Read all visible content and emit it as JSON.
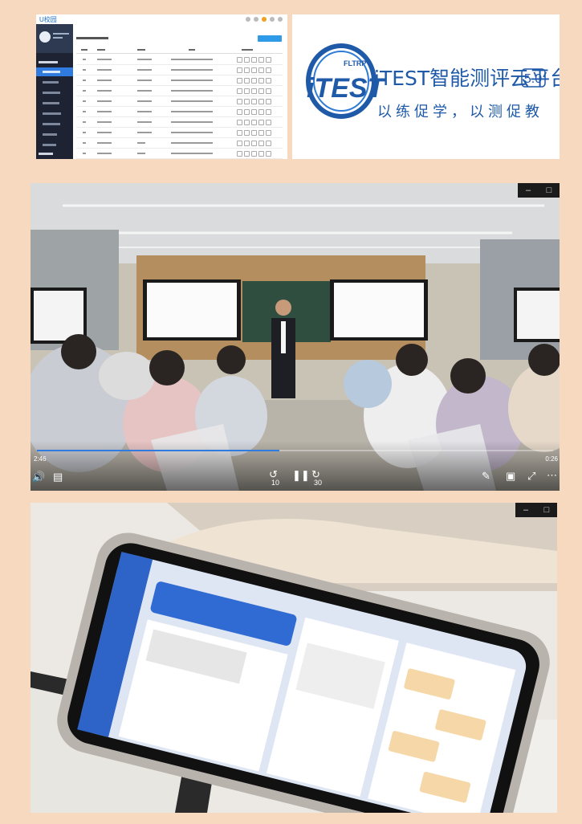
{
  "lms": {
    "logo": "U校园"
  },
  "itest": {
    "brand": "iTEST智能测评云平台",
    "version": "5.0",
    "slogan": "以练促学，以测促教",
    "badge_top": "FLTRP",
    "badge_main": "iTEST",
    "brand_blue": "#1f5aa8"
  },
  "video1": {
    "time_current": "2:46",
    "time_total": "0:26",
    "skip_back": "10",
    "skip_forward": "30",
    "progress": 0.47,
    "window_controls": [
      "–",
      "□"
    ]
  },
  "video2": {
    "window_controls": [
      "–",
      "□"
    ]
  },
  "icons": {
    "volume": "volume-icon",
    "captions": "captions-icon",
    "rewind": "rewind-icon",
    "pause": "pause-icon",
    "forward": "forward-icon",
    "pen": "pen-icon",
    "pip": "pip-icon",
    "fullscreen": "fullscreen-icon",
    "more": "more-icon"
  }
}
